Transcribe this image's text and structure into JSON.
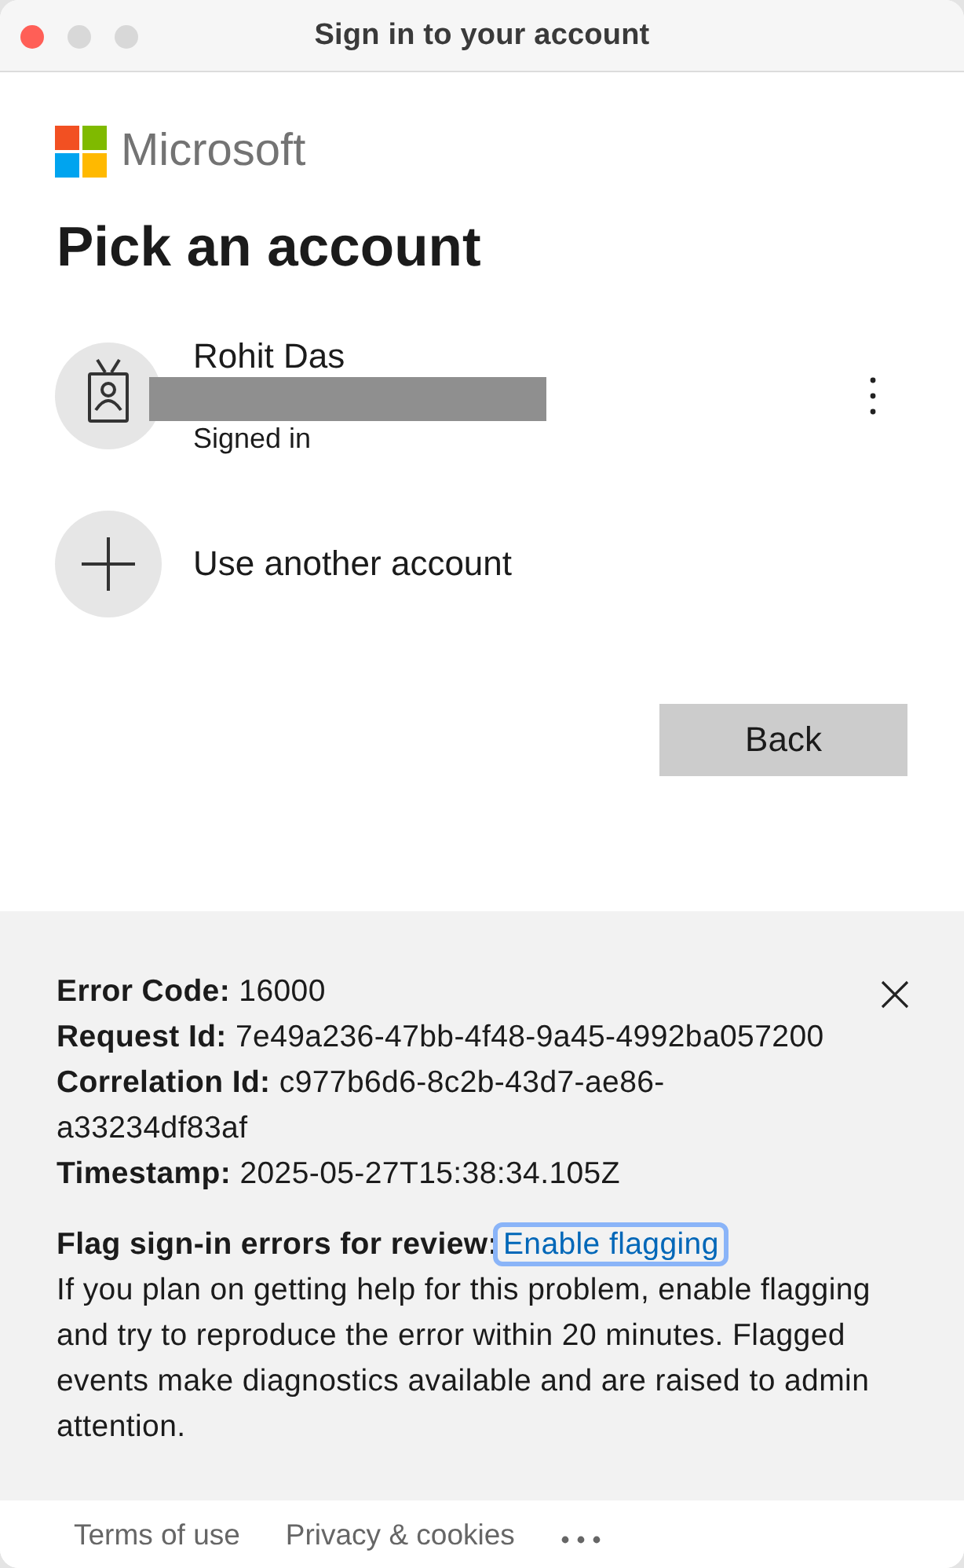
{
  "window": {
    "title": "Sign in to your account",
    "controls": [
      {
        "kind": "close",
        "enabled": true
      },
      {
        "kind": "minimize",
        "enabled": false
      },
      {
        "kind": "zoom",
        "enabled": false
      }
    ]
  },
  "brand": {
    "name": "Microsoft"
  },
  "heading": "Pick an account",
  "accounts": [
    {
      "kind": "user",
      "name": "Rohit Das",
      "email_redacted": true,
      "status": "Signed in"
    },
    {
      "kind": "add",
      "label": "Use another account"
    }
  ],
  "back_button": "Back",
  "error_panel": {
    "details": [
      "**Error Code:** 16000",
      "**Request Id:** 7e49a236-47bb-4f48-9a45-4992ba057200",
      "**Correlation Id:** c977b6d6-8c2b-43d7-ae86-a33234df83af",
      "**Timestamp:** 2025-05-27T15:38:34.105Z"
    ],
    "flag_label": "Flag sign-in errors for review:",
    "flag_link": {
      "label": "Enable flagging",
      "focused": true
    },
    "description": "If you plan on getting help for this problem, enable flagging and try to reproduce the error within 20 minutes. Flagged events make diagnostics available and are raised to admin attention."
  },
  "footer": {
    "links": [
      "Terms of use",
      "Privacy & cookies"
    ]
  }
}
